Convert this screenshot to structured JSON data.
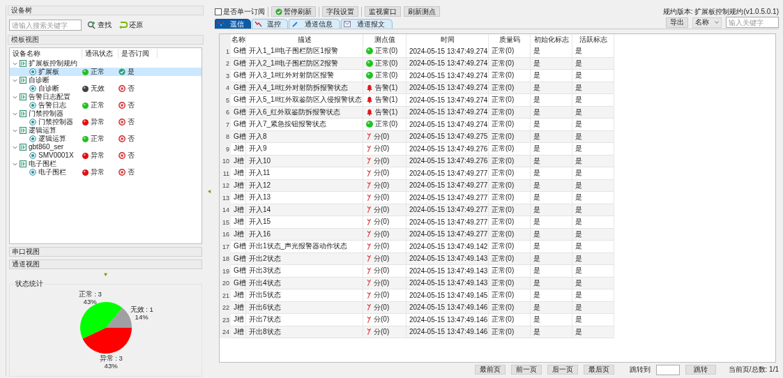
{
  "left": {
    "title": "设备树",
    "search": {
      "placeholder": "请输入搜索关键字"
    },
    "find_button": "查找",
    "restore_button": "还原",
    "tree": {
      "title": "模板视图",
      "columns": [
        "设备名称",
        "通讯状态",
        "是否订阅"
      ],
      "groups": [
        {
          "name": "扩展板控制规约",
          "expanded": true,
          "children": [
            {
              "name": "扩展板",
              "color": "#22c222",
              "status_text": "正常",
              "subscribed": true,
              "subscribed_text": "是",
              "selected": true
            }
          ]
        },
        {
          "name": "自诊断",
          "expanded": true,
          "children": [
            {
              "name": "自诊断",
              "color": "#404040",
              "status_text": "无效",
              "subscribed": false,
              "subscribed_text": "否",
              "selected": false
            }
          ]
        },
        {
          "name": "告警日志配置",
          "expanded": true,
          "children": [
            {
              "name": "告警日志",
              "color": "#22c222",
              "status_text": "正常",
              "subscribed": false,
              "subscribed_text": "否",
              "selected": false
            }
          ]
        },
        {
          "name": "门禁控制器",
          "expanded": true,
          "children": [
            {
              "name": "门禁控制器",
              "color": "#e01010",
              "status_text": "异常",
              "subscribed": false,
              "subscribed_text": "否",
              "selected": false
            }
          ]
        },
        {
          "name": "逻辑运算",
          "expanded": true,
          "children": [
            {
              "name": "逻辑运算",
              "color": "#22c222",
              "status_text": "正常",
              "subscribed": false,
              "subscribed_text": "否",
              "selected": false
            }
          ]
        },
        {
          "name": "gbt860_ser",
          "expanded": true,
          "children": [
            {
              "name": "SMV0001X",
              "color": "#e01010",
              "status_text": "异常",
              "subscribed": false,
              "subscribed_text": "否",
              "selected": false
            }
          ]
        },
        {
          "name": "电子围栏",
          "expanded": true,
          "children": [
            {
              "name": "电子围栏",
              "color": "#e01010",
              "status_text": "异常",
              "subscribed": false,
              "subscribed_text": "否",
              "selected": false
            }
          ]
        }
      ]
    },
    "sections": [
      "串口视图",
      "通道视图"
    ],
    "stats": {
      "labels": [
        {
          "color": "#00ff00"
        },
        {
          "color": "#a0a0a4"
        },
        {
          "color": "#ff0000"
        }
      ],
      "chart_data": {
        "type": "pie",
        "title": "状态统计",
        "categories": [
          "正常 : 3",
          "无效 : 1",
          "异常 : 3"
        ],
        "values": [
          43,
          14,
          43
        ],
        "value_labels": [
          "43%",
          "14%",
          "43%"
        ]
      }
    }
  },
  "toolbar": {
    "checkbox": {
      "label": "是否单一订阅",
      "checked": false
    },
    "buttons": [
      {
        "label": "暂停刷新",
        "kind": "icon"
      },
      {
        "label": "字段设置",
        "kind": "plain"
      },
      {
        "label": "监视窗口",
        "kind": "plain"
      },
      {
        "label": "刷新测点",
        "kind": "plain"
      }
    ],
    "version": "规约版本: 扩展板控制规约(v1.0.5.0.1)"
  },
  "tabs": [
    {
      "label": "遥信",
      "selected": true
    },
    {
      "label": "遥控",
      "selected": false
    },
    {
      "label": "通道信息",
      "selected": false
    },
    {
      "label": "通道报文",
      "selected": false
    }
  ],
  "filter": {
    "export_button": "导出",
    "field": "名称",
    "placeholder": "输入关键字"
  },
  "table": {
    "columns": [
      "名称",
      "描述",
      "测点值",
      "时间",
      "质量码",
      "初始化标志",
      "活跃标志"
    ],
    "rows": [
      {
        "no": "1",
        "name": "G槽",
        "desc": "开入1_1#电子围栏防区1报警",
        "kind": "normal",
        "value": "正常(0)",
        "time": "2024-05-15 13:47:49.274",
        "quality": "正常(0)",
        "init": "是",
        "active": "是"
      },
      {
        "no": "2",
        "name": "G槽",
        "desc": "开入2_1#电子围栏防区2报警",
        "kind": "normal",
        "value": "正常(0)",
        "time": "2024-05-15 13:47:49.274",
        "quality": "正常(0)",
        "init": "是",
        "active": "是"
      },
      {
        "no": "3",
        "name": "G槽",
        "desc": "开入3_1#红外对射防区报警",
        "kind": "normal",
        "value": "正常(0)",
        "time": "2024-05-15 13:47:49.274",
        "quality": "正常(0)",
        "init": "是",
        "active": "是"
      },
      {
        "no": "4",
        "name": "G槽",
        "desc": "开入4_1#红外对射防拆报警状态",
        "kind": "alarm",
        "value": "告警(1)",
        "time": "2024-05-15 13:47:49.274",
        "quality": "正常(0)",
        "init": "是",
        "active": "是"
      },
      {
        "no": "5",
        "name": "G槽",
        "desc": "开入5_1#红外双鉴防区入侵报警状态",
        "kind": "alarm",
        "value": "告警(1)",
        "time": "2024-05-15 13:47:49.274",
        "quality": "正常(0)",
        "init": "是",
        "active": "是"
      },
      {
        "no": "6",
        "name": "G槽",
        "desc": "开入6_红外双鉴防拆报警状态",
        "kind": "alarm",
        "value": "告警(1)",
        "time": "2024-05-15 13:47:49.274",
        "quality": "正常(0)",
        "init": "是",
        "active": "是"
      },
      {
        "no": "7",
        "name": "G槽",
        "desc": "开入7_紧急按钮报警状态",
        "kind": "normal",
        "value": "正常(0)",
        "time": "2024-05-15 13:47:49.274",
        "quality": "正常(0)",
        "init": "是",
        "active": "是"
      },
      {
        "no": "8",
        "name": "G槽",
        "desc": "开入8",
        "kind": "split",
        "value": "分(0)",
        "time": "2024-05-15 13:47:49.275",
        "quality": "正常(0)",
        "init": "是",
        "active": "是"
      },
      {
        "no": "9",
        "name": "J槽",
        "desc": "开入9",
        "kind": "split",
        "value": "分(0)",
        "time": "2024-05-15 13:47:49.276",
        "quality": "正常(0)",
        "init": "是",
        "active": "是"
      },
      {
        "no": "10",
        "name": "J槽",
        "desc": "开入10",
        "kind": "split",
        "value": "分(0)",
        "time": "2024-05-15 13:47:49.276",
        "quality": "正常(0)",
        "init": "是",
        "active": "是"
      },
      {
        "no": "11",
        "name": "J槽",
        "desc": "开入11",
        "kind": "split",
        "value": "分(0)",
        "time": "2024-05-15 13:47:49.277",
        "quality": "正常(0)",
        "init": "是",
        "active": "是"
      },
      {
        "no": "12",
        "name": "J槽",
        "desc": "开入12",
        "kind": "split",
        "value": "分(0)",
        "time": "2024-05-15 13:47:49.277",
        "quality": "正常(0)",
        "init": "是",
        "active": "是"
      },
      {
        "no": "13",
        "name": "J槽",
        "desc": "开入13",
        "kind": "split",
        "value": "分(0)",
        "time": "2024-05-15 13:47:49.277",
        "quality": "正常(0)",
        "init": "是",
        "active": "是"
      },
      {
        "no": "14",
        "name": "J槽",
        "desc": "开入14",
        "kind": "split",
        "value": "分(0)",
        "time": "2024-05-15 13:47:49.277",
        "quality": "正常(0)",
        "init": "是",
        "active": "是"
      },
      {
        "no": "15",
        "name": "J槽",
        "desc": "开入15",
        "kind": "split",
        "value": "分(0)",
        "time": "2024-05-15 13:47:49.277",
        "quality": "正常(0)",
        "init": "是",
        "active": "是"
      },
      {
        "no": "16",
        "name": "J槽",
        "desc": "开入16",
        "kind": "split",
        "value": "分(0)",
        "time": "2024-05-15 13:47:49.277",
        "quality": "正常(0)",
        "init": "是",
        "active": "是"
      },
      {
        "no": "17",
        "name": "G槽",
        "desc": "开出1状态_声光报警器动作状态",
        "kind": "split",
        "value": "分(0)",
        "time": "2024-05-15 13:47:49.142",
        "quality": "正常(0)",
        "init": "是",
        "active": "是"
      },
      {
        "no": "18",
        "name": "G槽",
        "desc": "开出2状态",
        "kind": "split",
        "value": "分(0)",
        "time": "2024-05-15 13:47:49.143",
        "quality": "正常(0)",
        "init": "是",
        "active": "是"
      },
      {
        "no": "19",
        "name": "G槽",
        "desc": "开出3状态",
        "kind": "split",
        "value": "分(0)",
        "time": "2024-05-15 13:47:49.143",
        "quality": "正常(0)",
        "init": "是",
        "active": "是"
      },
      {
        "no": "20",
        "name": "G槽",
        "desc": "开出4状态",
        "kind": "split",
        "value": "分(0)",
        "time": "2024-05-15 13:47:49.143",
        "quality": "正常(0)",
        "init": "是",
        "active": "是"
      },
      {
        "no": "21",
        "name": "J槽",
        "desc": "开出5状态",
        "kind": "split",
        "value": "分(0)",
        "time": "2024-05-15 13:47:49.145",
        "quality": "正常(0)",
        "init": "是",
        "active": "是"
      },
      {
        "no": "22",
        "name": "J槽",
        "desc": "开出6状态",
        "kind": "split",
        "value": "分(0)",
        "time": "2024-05-15 13:47:49.146",
        "quality": "正常(0)",
        "init": "是",
        "active": "是"
      },
      {
        "no": "23",
        "name": "J槽",
        "desc": "开出7状态",
        "kind": "split",
        "value": "分(0)",
        "time": "2024-05-15 13:47:49.146",
        "quality": "正常(0)",
        "init": "是",
        "active": "是"
      },
      {
        "no": "24",
        "name": "J槽",
        "desc": "开出8状态",
        "kind": "split",
        "value": "分(0)",
        "time": "2024-05-15 13:47:49.146",
        "quality": "正常(0)",
        "init": "是",
        "active": "是"
      }
    ]
  },
  "pager": {
    "buttons": [
      "最前页",
      "前一页",
      "后一页",
      "最后页"
    ],
    "jump_label": "跳转到",
    "jump_button": "跳转",
    "page_info": "当前页/总数: 1/1"
  }
}
